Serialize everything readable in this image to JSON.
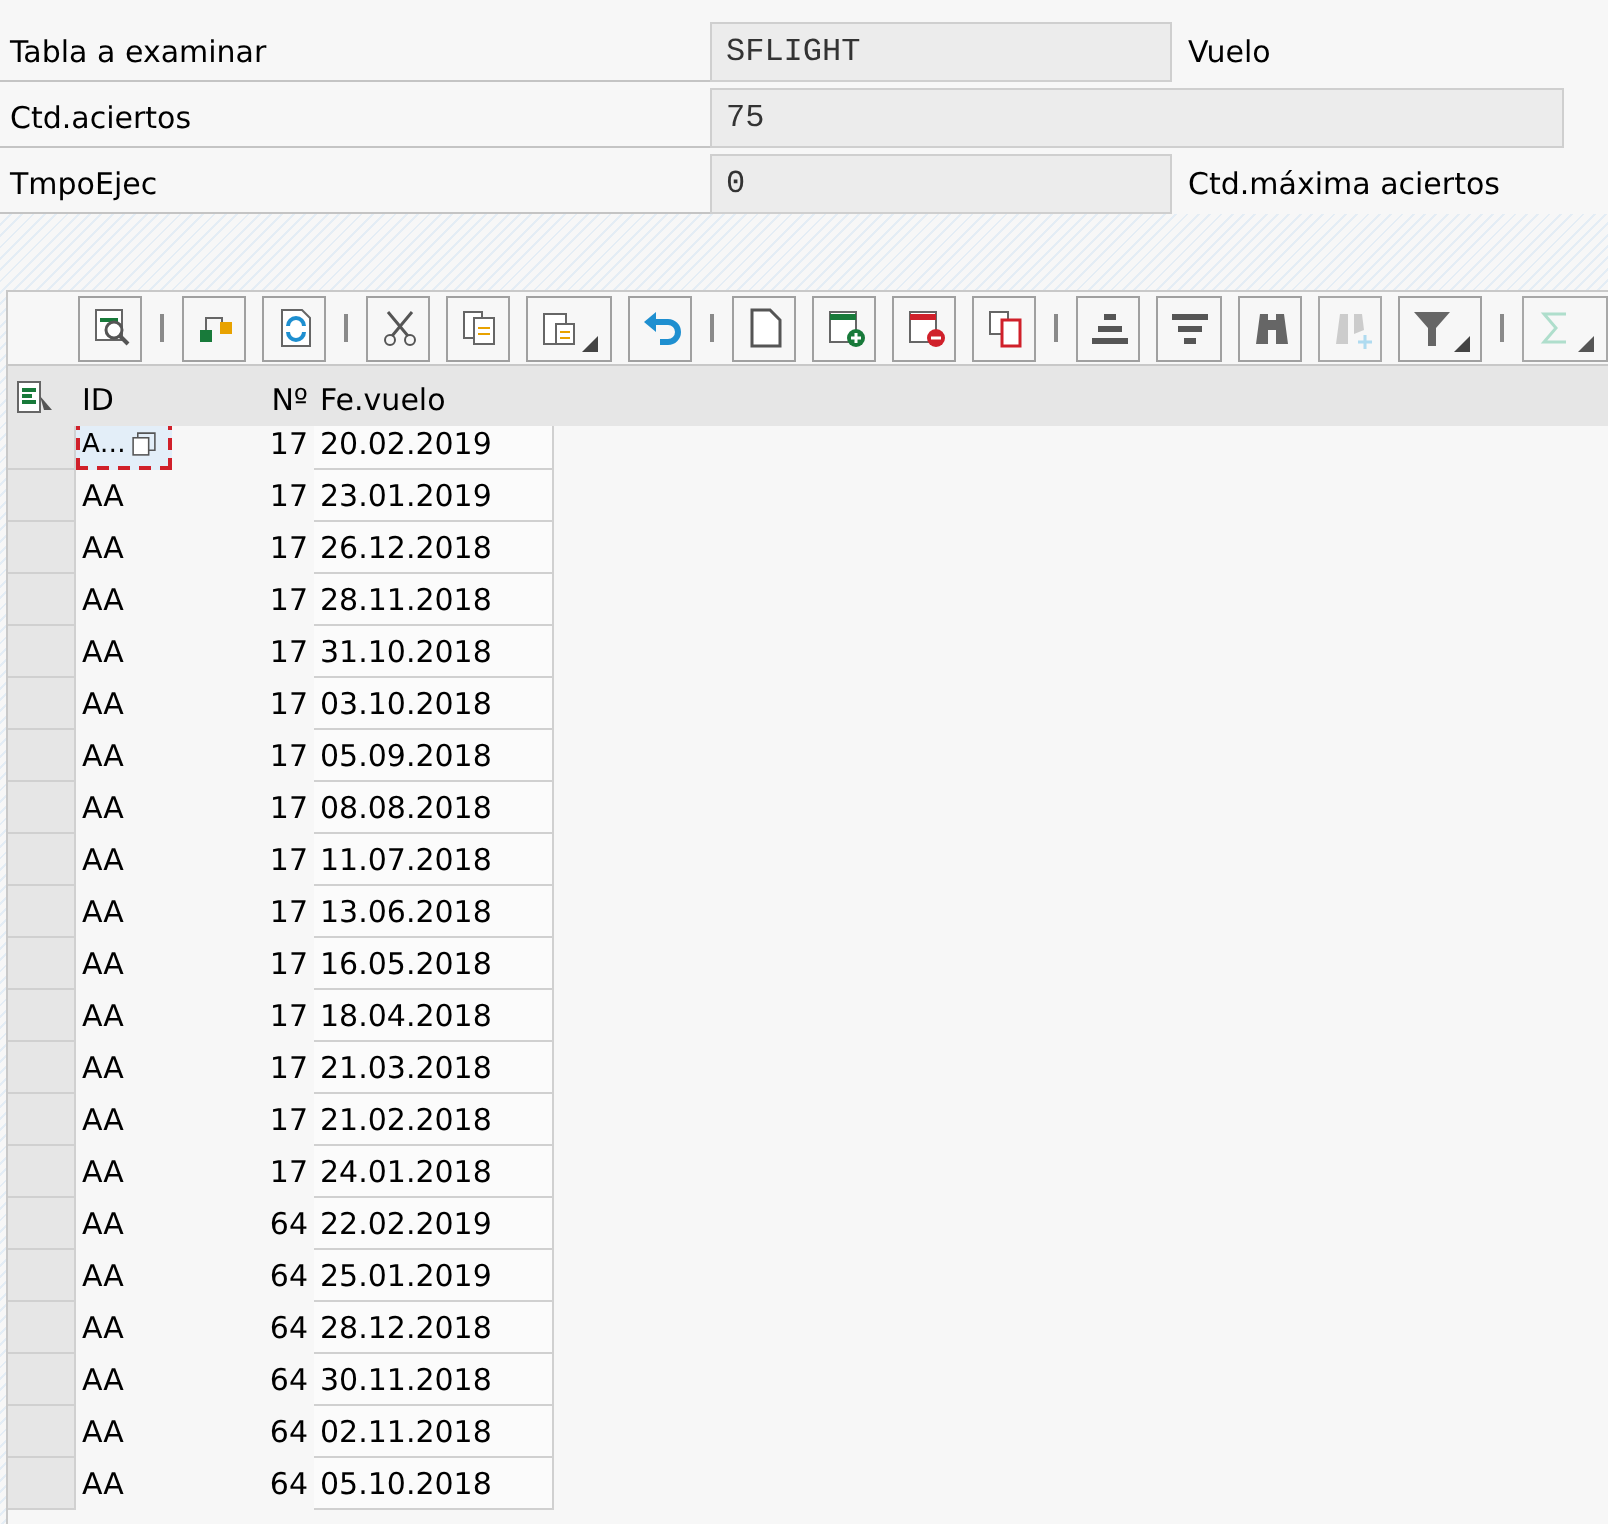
{
  "form": [
    {
      "label": "Tabla a examinar",
      "value": "SFLIGHT",
      "note": "Vuelo",
      "wide": false
    },
    {
      "label": "Ctd.aciertos",
      "value": "75",
      "wide": true
    },
    {
      "label": "TmpoEjec",
      "value": "0",
      "note": "Ctd.máxima aciertos",
      "wide": false
    }
  ],
  "toolbar": [
    {
      "kind": "button",
      "disabled": false
    },
    {
      "kind": "separator"
    },
    {
      "kind": "button",
      "disabled": false
    },
    {
      "kind": "button",
      "disabled": false
    },
    {
      "kind": "separator"
    },
    {
      "kind": "button",
      "disabled": false
    },
    {
      "kind": "button",
      "disabled": false
    },
    {
      "kind": "dropdown",
      "disabled": false
    },
    {
      "kind": "button",
      "disabled": false
    },
    {
      "kind": "separator"
    },
    {
      "kind": "button",
      "disabled": false
    },
    {
      "kind": "button",
      "disabled": false
    },
    {
      "kind": "button",
      "disabled": false
    },
    {
      "kind": "button",
      "disabled": false
    },
    {
      "kind": "separator"
    },
    {
      "kind": "button",
      "disabled": false
    },
    {
      "kind": "button",
      "disabled": false
    },
    {
      "kind": "button",
      "disabled": false
    },
    {
      "kind": "button",
      "disabled": true
    },
    {
      "kind": "dropdown",
      "disabled": false
    },
    {
      "kind": "separator"
    },
    {
      "kind": "dropdown",
      "disabled": true
    }
  ],
  "table": {
    "columns": [
      "ID",
      "Nº",
      "Fe.vuelo"
    ],
    "rows": [
      {
        "id": "A…",
        "no": "17",
        "date": "20.02.2019",
        "selected": true
      },
      {
        "id": "AA",
        "no": "17",
        "date": "23.01.2019",
        "selected": false
      },
      {
        "id": "AA",
        "no": "17",
        "date": "26.12.2018",
        "selected": false
      },
      {
        "id": "AA",
        "no": "17",
        "date": "28.11.2018",
        "selected": false
      },
      {
        "id": "AA",
        "no": "17",
        "date": "31.10.2018",
        "selected": false
      },
      {
        "id": "AA",
        "no": "17",
        "date": "03.10.2018",
        "selected": false
      },
      {
        "id": "AA",
        "no": "17",
        "date": "05.09.2018",
        "selected": false
      },
      {
        "id": "AA",
        "no": "17",
        "date": "08.08.2018",
        "selected": false
      },
      {
        "id": "AA",
        "no": "17",
        "date": "11.07.2018",
        "selected": false
      },
      {
        "id": "AA",
        "no": "17",
        "date": "13.06.2018",
        "selected": false
      },
      {
        "id": "AA",
        "no": "17",
        "date": "16.05.2018",
        "selected": false
      },
      {
        "id": "AA",
        "no": "17",
        "date": "18.04.2018",
        "selected": false
      },
      {
        "id": "AA",
        "no": "17",
        "date": "21.03.2018",
        "selected": false
      },
      {
        "id": "AA",
        "no": "17",
        "date": "21.02.2018",
        "selected": false
      },
      {
        "id": "AA",
        "no": "17",
        "date": "24.01.2018",
        "selected": false
      },
      {
        "id": "AA",
        "no": "64",
        "date": "22.02.2019",
        "selected": false
      },
      {
        "id": "AA",
        "no": "64",
        "date": "25.01.2019",
        "selected": false
      },
      {
        "id": "AA",
        "no": "64",
        "date": "28.12.2018",
        "selected": false
      },
      {
        "id": "AA",
        "no": "64",
        "date": "30.11.2018",
        "selected": false
      },
      {
        "id": "AA",
        "no": "64",
        "date": "02.11.2018",
        "selected": false
      },
      {
        "id": "AA",
        "no": "64",
        "date": "05.10.2018",
        "selected": false
      }
    ]
  }
}
